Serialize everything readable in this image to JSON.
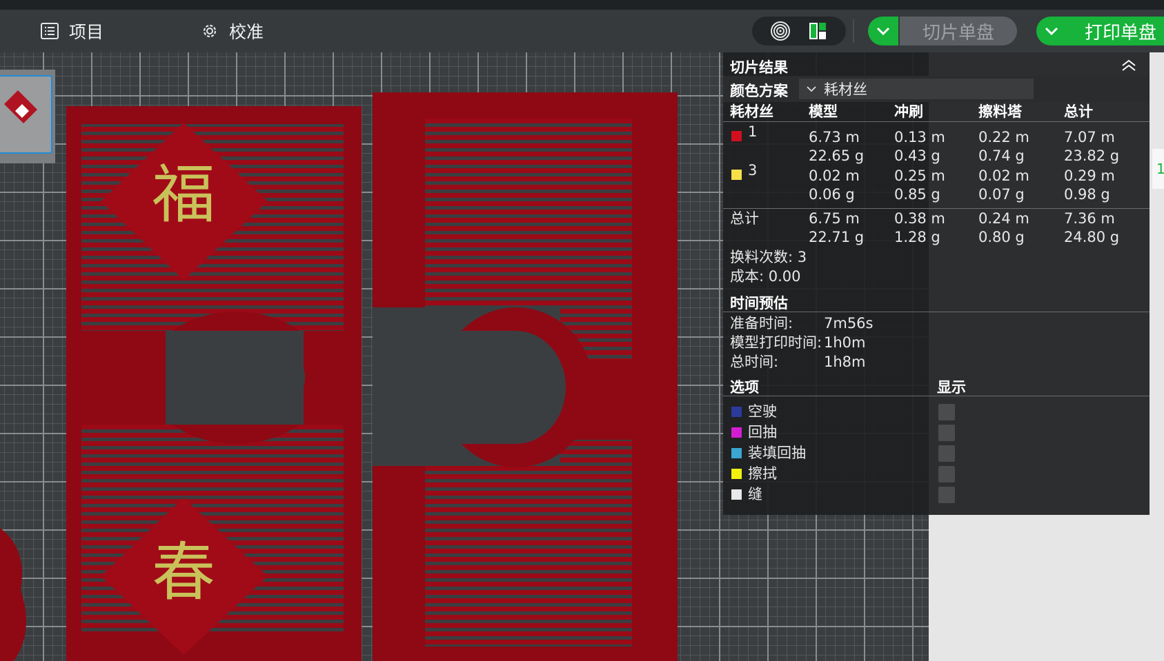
{
  "toolbar": {
    "project_label": "项目",
    "calibrate_label": "校准",
    "slice_label": "切片单盘",
    "print_label": "打印单盘"
  },
  "icons": {
    "project": "list-icon",
    "calibrate": "gear-icon",
    "preview_view": "spiral-icon",
    "layout_view": "layout-grid-icon",
    "dropdown": "chevron-down-icon",
    "collapse": "double-chevron-up-icon"
  },
  "colors": {
    "accent_green": "#17b33a",
    "model_red": "#9b0a16",
    "text_gold": "#c9c25a"
  },
  "model_text": {
    "top": "福",
    "bottom": "春"
  },
  "slice_result": {
    "title": "切片结果",
    "color_scheme_label": "颜色方案",
    "color_scheme_value": "耗材丝",
    "headers": [
      "耗材丝",
      "模型",
      "冲刷",
      "擦料塔",
      "总计"
    ],
    "rows": [
      {
        "id": "1",
        "color": "#d0101e",
        "model": [
          "6.73 m",
          "22.65 g"
        ],
        "flush": [
          "0.13 m",
          "0.43 g"
        ],
        "tower": [
          "0.22 m",
          "0.74 g"
        ],
        "total": [
          "7.07 m",
          "23.82 g"
        ]
      },
      {
        "id": "3",
        "color": "#f5e04a",
        "model": [
          "0.02 m",
          "0.06 g"
        ],
        "flush": [
          "0.25 m",
          "0.85 g"
        ],
        "tower": [
          "0.02 m",
          "0.07 g"
        ],
        "total": [
          "0.29 m",
          "0.98 g"
        ]
      }
    ],
    "sum_row": {
      "label": "总计",
      "model": [
        "6.75 m",
        "22.71 g"
      ],
      "flush": [
        "0.38 m",
        "1.28 g"
      ],
      "tower": [
        "0.24 m",
        "0.80 g"
      ],
      "total": [
        "7.36 m",
        "24.80 g"
      ]
    },
    "filament_changes": "换料次数: 3",
    "cost": "成本: 0.00",
    "time_title": "时间预估",
    "prep_label": "准备时间:",
    "prep_value": "7m56s",
    "model_time_label": "模型打印时间:",
    "model_time_value": "1h0m",
    "total_time_label": "总时间:",
    "total_time_value": "1h8m",
    "options_title": "选项",
    "display_title": "显示",
    "options": [
      {
        "label": "空驶",
        "color": "#2c3a9c"
      },
      {
        "label": "回抽",
        "color": "#d21ed2"
      },
      {
        "label": "装填回抽",
        "color": "#3aa6d2"
      },
      {
        "label": "擦拭",
        "color": "#f2f20e"
      },
      {
        "label": "缝",
        "color": "#e8e8e8"
      }
    ]
  },
  "right_edge_label": "1"
}
